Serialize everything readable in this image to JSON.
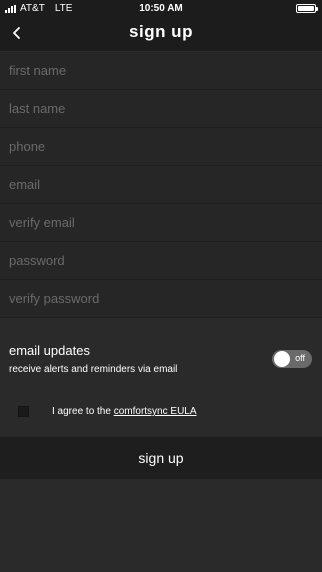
{
  "status_bar": {
    "carrier": "AT&T",
    "network": "LTE",
    "time": "10:50 AM"
  },
  "nav": {
    "title": "sign up",
    "back_icon": "chevron-left-icon"
  },
  "fields": {
    "first_name": {
      "placeholder": "first name",
      "value": ""
    },
    "last_name": {
      "placeholder": "last name",
      "value": ""
    },
    "phone": {
      "placeholder": "phone",
      "value": ""
    },
    "email": {
      "placeholder": "email",
      "value": ""
    },
    "verify_email": {
      "placeholder": "verify email",
      "value": ""
    },
    "password": {
      "placeholder": "password",
      "value": ""
    },
    "verify_password": {
      "placeholder": "verify password",
      "value": ""
    }
  },
  "email_updates": {
    "title": "email updates",
    "subtitle": "receive alerts and reminders via email",
    "toggle_label": "off",
    "enabled": false
  },
  "eula": {
    "prefix": "I agree to the",
    "link": "comfortsync EULA",
    "checked": false
  },
  "signup_button": {
    "label": "sign up"
  },
  "colors": {
    "background": "#2a2a2a",
    "bar": "#1c1c1c",
    "field": "#262626",
    "placeholder": "#6a6a6a",
    "toggle_off": "#6a6a6a"
  }
}
